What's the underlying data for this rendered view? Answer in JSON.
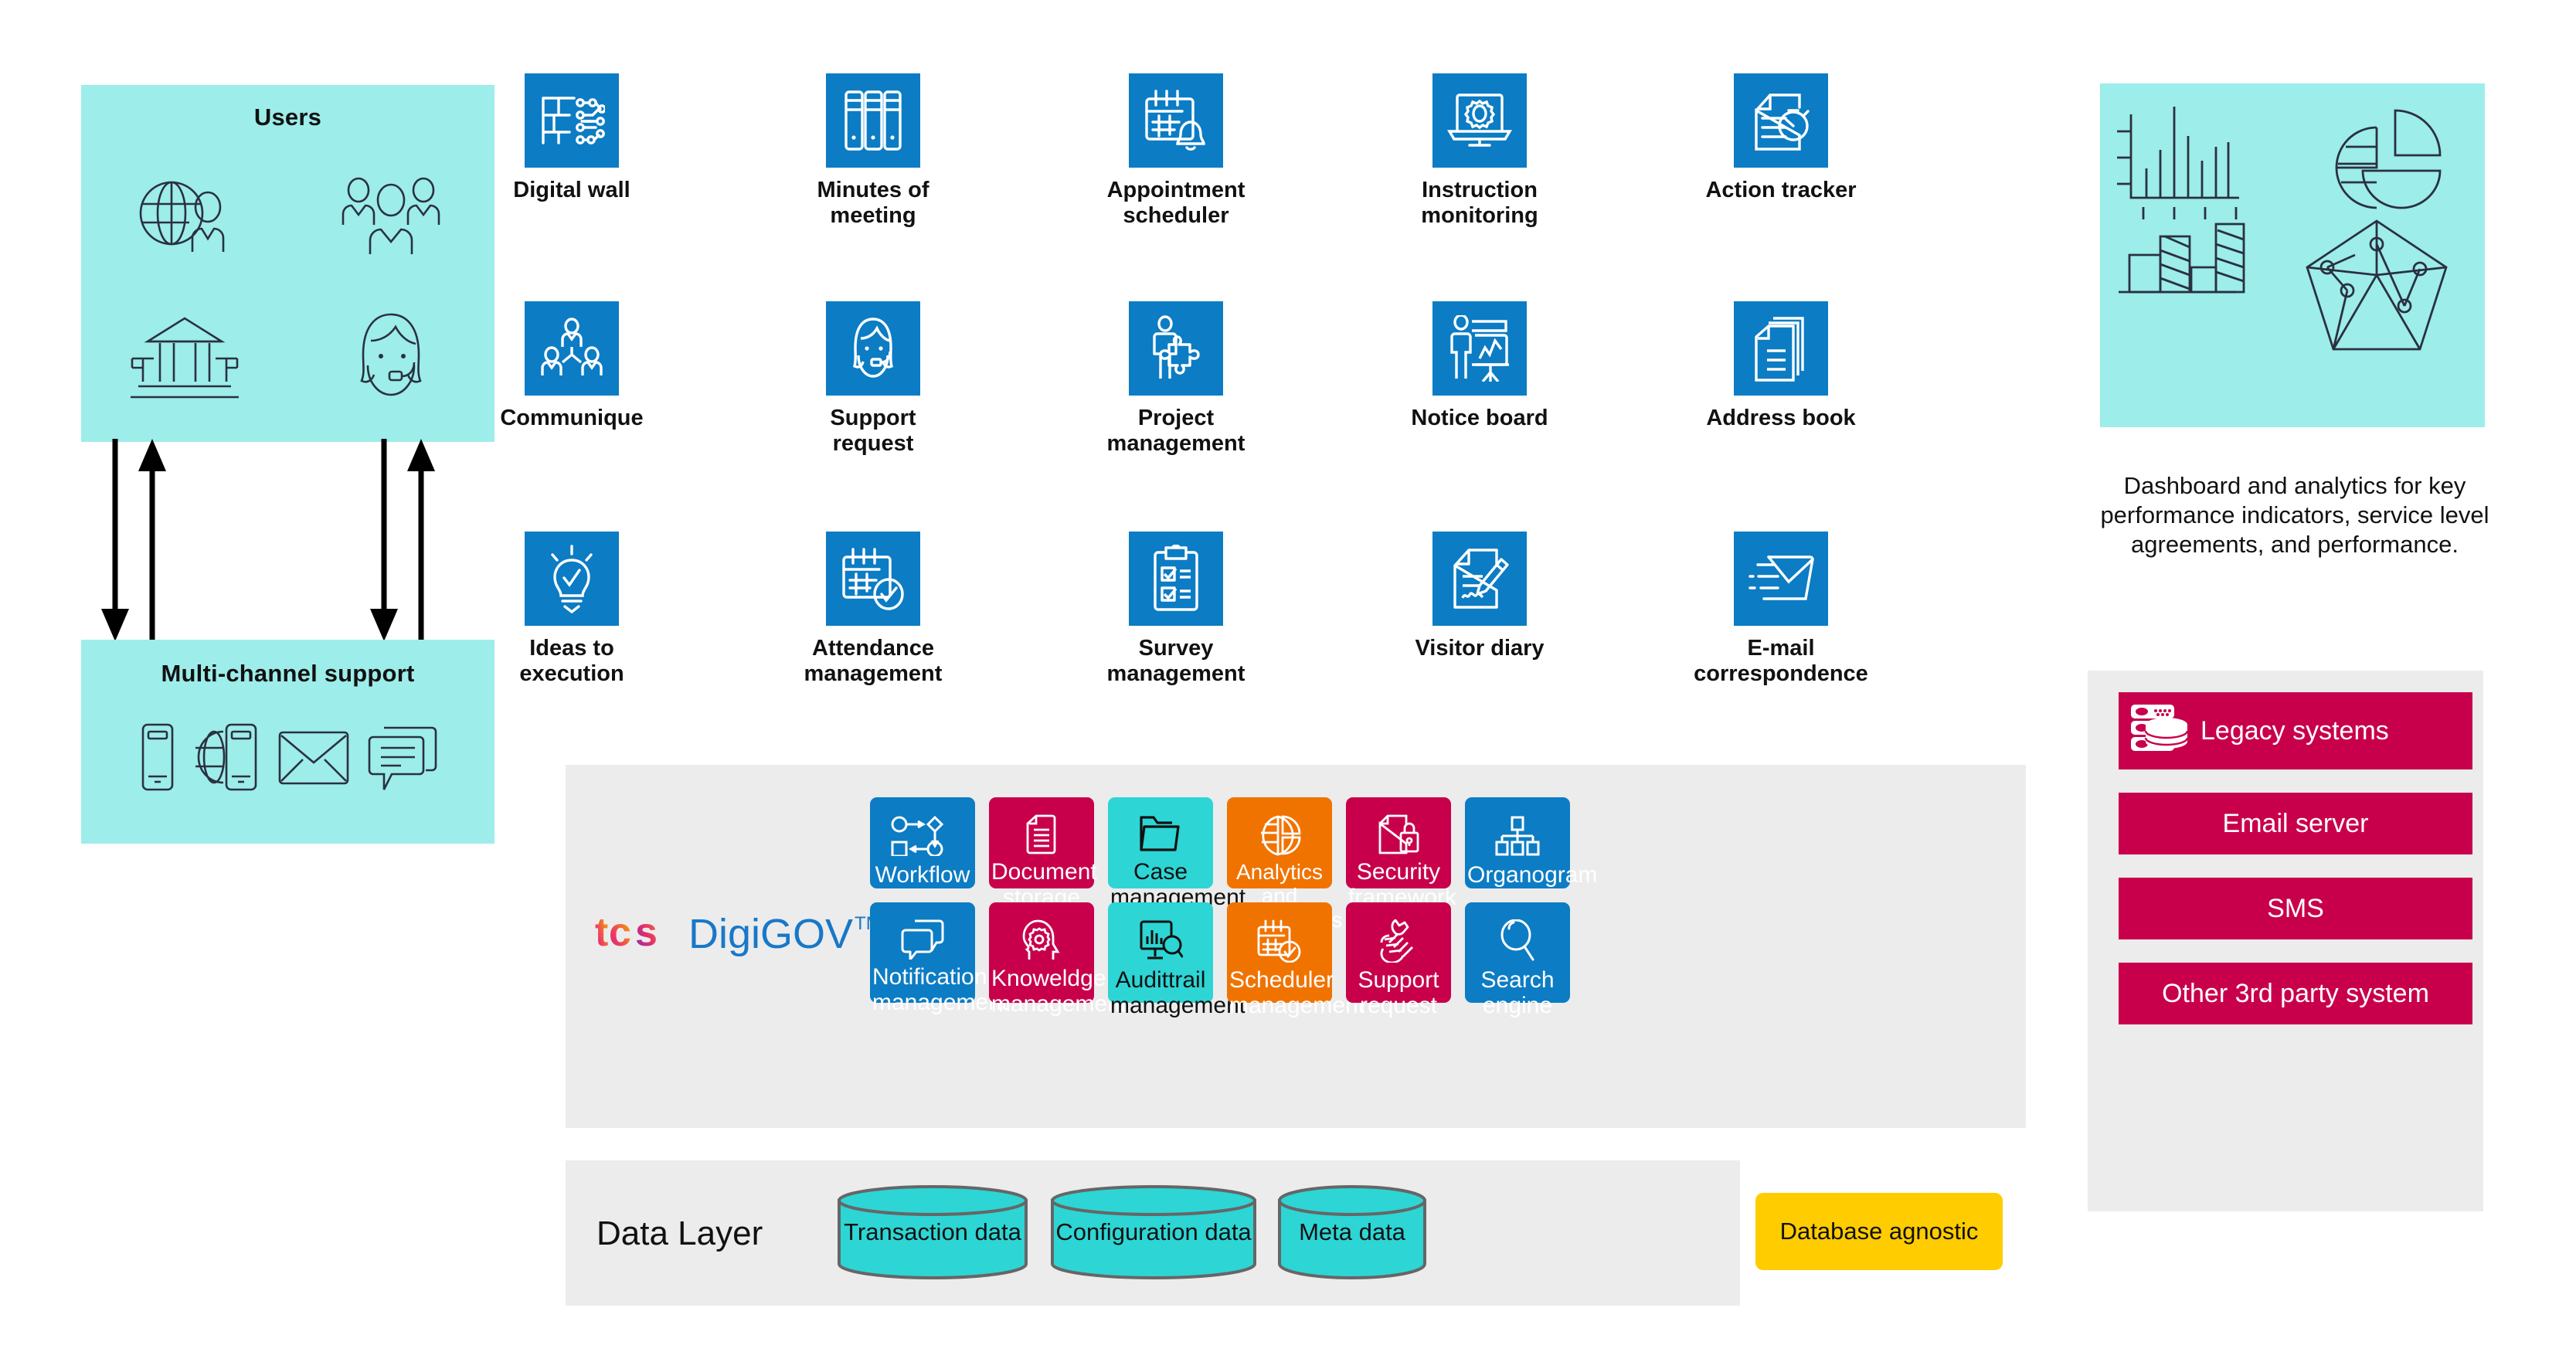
{
  "colors": {
    "aqua": "#9DEDEA",
    "tile_blue": "#0C7CC4",
    "platform_blue": "#0C7CC4",
    "platform_crimson": "#C8004B",
    "platform_turquoise": "#2DD5D5",
    "platform_orange": "#F07300",
    "band_grey": "#ECECEC",
    "cylinder_teal": "#2DD5D5",
    "yellow": "#FFCC00",
    "outline": "#2A3140"
  },
  "users_box": {
    "title": "Users",
    "icons": [
      "globe-user-icon",
      "group-people-icon",
      "government-building-icon",
      "support-agent-icon"
    ]
  },
  "multichannel_box": {
    "title": "Multi-channel support",
    "icons": [
      "mobile-phone-icon",
      "globe-mobile-icon",
      "envelope-icon",
      "chat-bubbles-icon"
    ]
  },
  "flow_arrows": {
    "count": 4,
    "description": "bidirectional arrows between Users and Multi-channel support"
  },
  "modules": [
    {
      "label": "Digital wall",
      "icon": "digital-wall-icon",
      "row": 1,
      "col": 1
    },
    {
      "label": "Minutes of\nmeeting",
      "icon": "binders-icon",
      "row": 1,
      "col": 2
    },
    {
      "label": "Appointment\nscheduler",
      "icon": "calendar-bell-icon",
      "row": 1,
      "col": 3
    },
    {
      "label": "Instruction\nmonitoring",
      "icon": "monitor-gear-icon",
      "row": 1,
      "col": 4
    },
    {
      "label": "Action tracker",
      "icon": "document-stopwatch-icon",
      "row": 1,
      "col": 5
    },
    {
      "label": "Communique",
      "icon": "org-people-icon",
      "row": 2,
      "col": 1
    },
    {
      "label": "Support\nrequest",
      "icon": "headset-agent-icon",
      "row": 2,
      "col": 2
    },
    {
      "label": "Project\nmanagement",
      "icon": "person-puzzle-icon",
      "row": 2,
      "col": 3
    },
    {
      "label": "Notice board",
      "icon": "presentation-board-icon",
      "row": 2,
      "col": 4
    },
    {
      "label": "Address book",
      "icon": "address-pages-icon",
      "row": 2,
      "col": 5
    },
    {
      "label": "Ideas to\nexecution",
      "icon": "lightbulb-check-icon",
      "row": 3,
      "col": 1
    },
    {
      "label": "Attendance\nmanagement",
      "icon": "calendar-check-icon",
      "row": 3,
      "col": 2
    },
    {
      "label": "Survey\nmanagement",
      "icon": "clipboard-checklist-icon",
      "row": 3,
      "col": 3
    },
    {
      "label": "Visitor diary",
      "icon": "document-pen-icon",
      "row": 3,
      "col": 4
    },
    {
      "label": "E-mail\ncorrespondence",
      "icon": "email-send-icon",
      "row": 3,
      "col": 5
    }
  ],
  "platform": {
    "logo": {
      "brand": "tcs",
      "product": "DigiGOV",
      "trademark": "TM"
    },
    "tiles_row1": [
      {
        "label": "Workflow",
        "icon": "workflow-diagram-icon",
        "color": "#0C7CC4",
        "text": "#ffffff"
      },
      {
        "label": "Document\nstorage",
        "icon": "document-lines-icon",
        "color": "#C8004B",
        "text": "#ffffff"
      },
      {
        "label": "Case\nmanagement",
        "icon": "folder-open-icon",
        "color": "#2DD5D5",
        "text": "#111111"
      },
      {
        "label": "Analytics and\ndashboards",
        "icon": "pie-chart-icon",
        "color": "#F07300",
        "text": "#ffffff"
      },
      {
        "label": "Security\nframework",
        "icon": "document-lock-icon",
        "color": "#C8004B",
        "text": "#ffffff"
      },
      {
        "label": "Organogram",
        "icon": "org-chart-icon",
        "color": "#0C7CC4",
        "text": "#ffffff"
      }
    ],
    "tiles_row2": [
      {
        "label": "Notification\nmanagement",
        "icon": "chat-bubbles-icon",
        "color": "#0C7CC4",
        "text": "#ffffff"
      },
      {
        "label": "Knoweldge\nmanagement",
        "icon": "head-gear-icon",
        "color": "#C8004B",
        "text": "#ffffff"
      },
      {
        "label": "Audittrail\nmanagement",
        "icon": "monitor-chart-search-icon",
        "color": "#2DD5D5",
        "text": "#111111"
      },
      {
        "label": "Scheduler\nmanagement",
        "icon": "calendar-check-icon",
        "color": "#F07300",
        "text": "#ffffff"
      },
      {
        "label": "Support\nrequest",
        "icon": "wrench-hand-icon",
        "color": "#C8004B",
        "text": "#ffffff"
      },
      {
        "label": "Search\nengine",
        "icon": "magnifier-icon",
        "color": "#0C7CC4",
        "text": "#ffffff"
      }
    ]
  },
  "data_layer": {
    "title": "Data Layer",
    "stores": [
      "Transaction data",
      "Configuration data",
      "Meta data"
    ],
    "badge": "Database agnostic"
  },
  "dashboard_panel": {
    "icons": [
      "bar-chart-icon",
      "pie-chart-icon",
      "hatched-bar-chart-icon",
      "radar-network-icon"
    ],
    "caption": "Dashboard and analytics for key performance indicators, service level agreements, and performance."
  },
  "external_systems": [
    {
      "label": "Legacy systems",
      "icon": "server-database-icon",
      "has_icon": true
    },
    {
      "label": "Email server",
      "icon": "",
      "has_icon": false
    },
    {
      "label": "SMS",
      "icon": "",
      "has_icon": false
    },
    {
      "label": "Other 3rd party system",
      "icon": "",
      "has_icon": false
    }
  ]
}
